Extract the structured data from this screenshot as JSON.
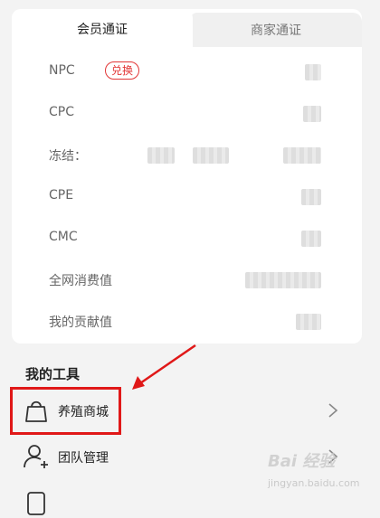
{
  "tabs": {
    "member": "会员通证",
    "merchant": "商家通证"
  },
  "rows": [
    {
      "label": "NPC",
      "badge": "兑换"
    },
    {
      "label": "CPC"
    },
    {
      "label": "冻结："
    },
    {
      "label": "CPE"
    },
    {
      "label": "CMC"
    },
    {
      "label": "全网消费值"
    },
    {
      "label": "我的贡献值"
    }
  ],
  "tools": {
    "title": "我的工具",
    "items": [
      {
        "label": "养殖商城",
        "icon": "shopping-bag-icon"
      },
      {
        "label": "团队管理",
        "icon": "add-user-icon"
      }
    ]
  },
  "watermark": {
    "brand": "Bai 经验",
    "url": "jingyan.baidu.com"
  },
  "colors": {
    "accent": "#e23636",
    "highlight": "#e01818"
  }
}
